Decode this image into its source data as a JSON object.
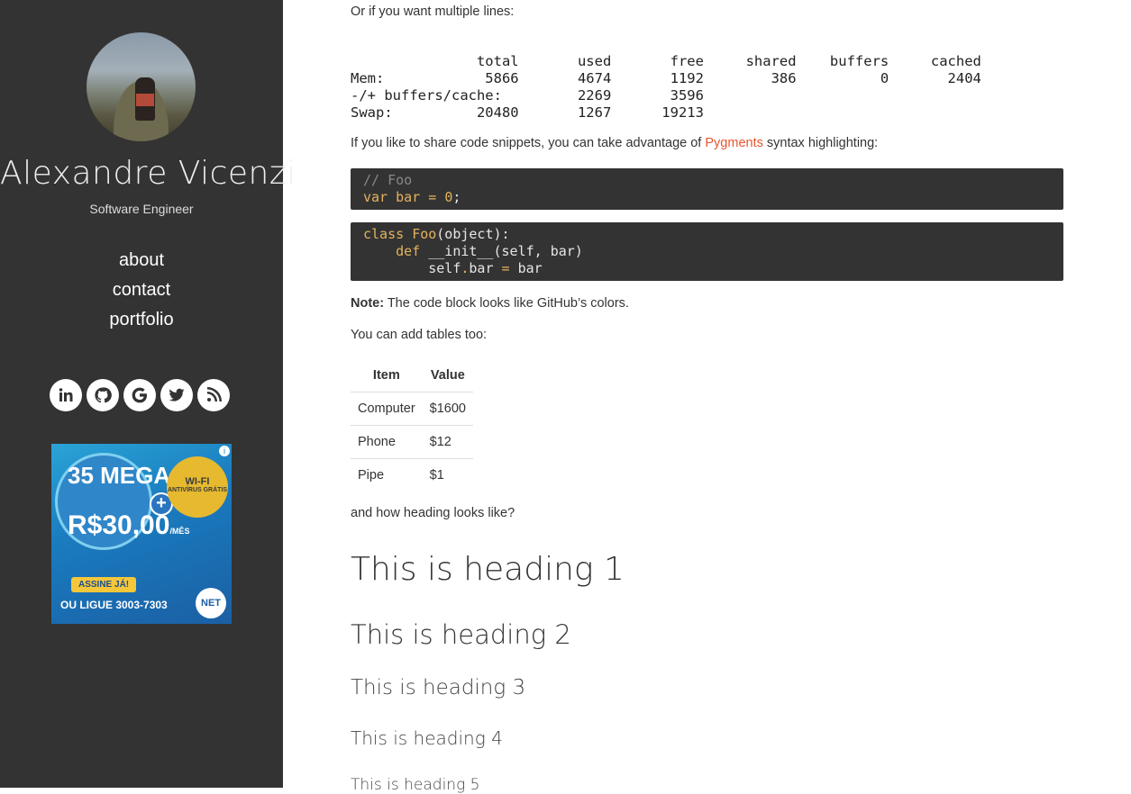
{
  "sidebar": {
    "name": "Alexandre Vicenzi",
    "role": "Software Engineer",
    "nav": [
      "about",
      "contact",
      "portfolio"
    ],
    "social_icons": [
      "linkedin-icon",
      "github-icon",
      "google-icon",
      "twitter-icon",
      "rss-icon"
    ],
    "ad": {
      "info": "i",
      "mega": "35 MEGA",
      "price": "R$30,00",
      "price_unit": "/MÊS",
      "plus": "+",
      "wifi": "WI-FI",
      "wifi_sub": "ANTIVÍRUS GRÁTIS",
      "cta": "ASSINE JÁ!",
      "phone": "OU LIGUE 3003-7303",
      "brand": "NET"
    }
  },
  "content": {
    "multi_lines_intro": "Or if you want multiple lines:",
    "mem_table": "               total       used       free     shared    buffers     cached\nMem:            5866       4674       1192        386          0       2404\n-/+ buffers/cache:         2269       3596\nSwap:          20480       1267      19213",
    "pygments_before": "If you like to share code snippets, you can take advantage of ",
    "pygments_link": "Pygments",
    "pygments_after": " syntax highlighting:",
    "code1_comment": "// Foo",
    "code1_kw": "var",
    "code1_var": "bar",
    "code1_op": "=",
    "code1_num": "0",
    "code1_end": ";",
    "code2_kw": "class",
    "code2_cls": "Foo",
    "code2_rest": "(object):",
    "code2_def": "def",
    "code2_sig": " __init__(self, bar)",
    "code2_self": "self",
    "code2_dot": ".",
    "code2_attr": "bar",
    "code2_eq": "=",
    "code2_val": "bar",
    "note_label": "Note:",
    "note_text": " The code block looks like GitHub’s colors.",
    "tables_intro": "You can add tables too:",
    "table": {
      "headers": [
        "Item",
        "Value"
      ],
      "rows": [
        [
          "Computer",
          "$1600"
        ],
        [
          "Phone",
          "$12"
        ],
        [
          "Pipe",
          "$1"
        ]
      ]
    },
    "heading_intro": "and how heading looks like?",
    "h1": "This is heading 1",
    "h2": "This is heading 2",
    "h3": "This is heading 3",
    "h4": "This is heading 4",
    "h5": "This is heading 5"
  }
}
